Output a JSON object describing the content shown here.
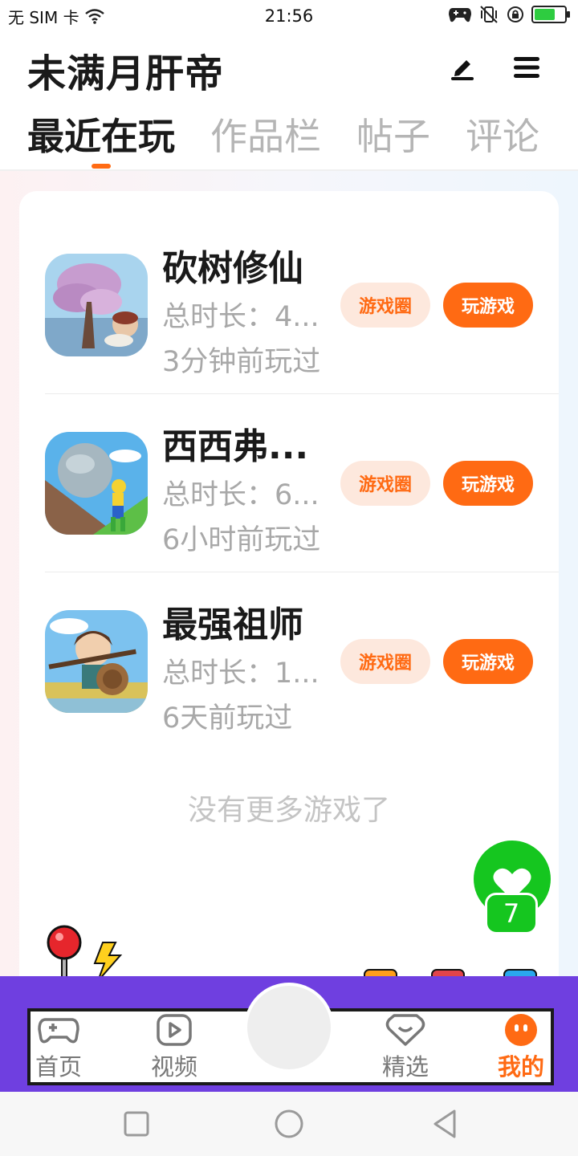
{
  "status_bar": {
    "carrier": "无 SIM 卡",
    "time": "21:56",
    "battery_fill": 0.7
  },
  "header": {
    "title": "未满月肝帝",
    "edit_icon": "pen-icon",
    "menu_icon": "hamburger-icon"
  },
  "tabs": [
    {
      "label": "最近在玩",
      "active": true
    },
    {
      "label": "作品栏",
      "active": false
    },
    {
      "label": "帖子",
      "active": false
    },
    {
      "label": "评论",
      "active": false
    }
  ],
  "games": [
    {
      "name": "砍树修仙",
      "duration": "总时长：4...",
      "last_played": "3分钟前玩过",
      "circle_label": "游戏圈",
      "play_label": "玩游戏"
    },
    {
      "name": "西西弗...",
      "duration": "总时长：6...",
      "last_played": "6小时前玩过",
      "circle_label": "游戏圈",
      "play_label": "玩游戏"
    },
    {
      "name": "最强祖师",
      "duration": "总时长：1...",
      "last_played": "6天前玩过",
      "circle_label": "游戏圈",
      "play_label": "玩游戏"
    }
  ],
  "footer_note": "没有更多游戏了",
  "like": {
    "count": "7"
  },
  "bottom_nav": [
    {
      "label": "首页",
      "icon": "gamepad-icon",
      "active": false
    },
    {
      "label": "视频",
      "icon": "video-icon",
      "active": false
    },
    {
      "label": "精选",
      "icon": "heart-chat-icon",
      "active": false
    },
    {
      "label": "我的",
      "icon": "profile-face-icon",
      "active": true
    }
  ],
  "colors": {
    "accent": "#ff6a13",
    "accent_light": "#fde8dd",
    "like_green": "#15c61f",
    "nav_purple": "#6f3fe0"
  }
}
